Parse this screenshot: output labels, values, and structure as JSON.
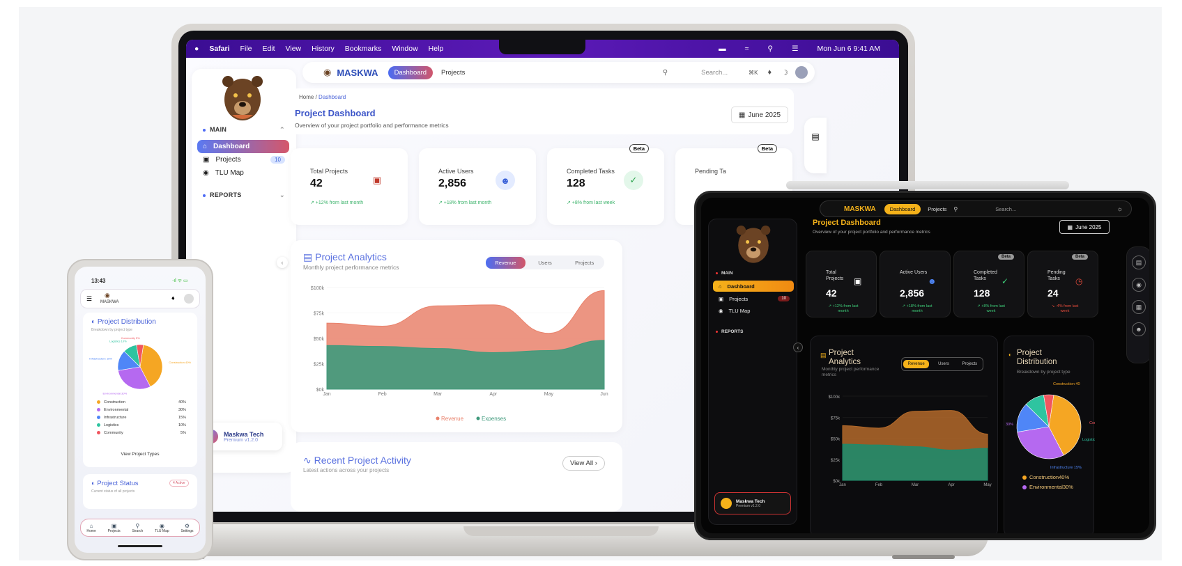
{
  "laptop": {
    "menubar": {
      "apple": "",
      "app": "Safari",
      "menus": [
        "File",
        "Edit",
        "View",
        "History",
        "Bookmarks",
        "Window",
        "Help"
      ],
      "datetime": "Mon Jun 6  9:41 AM"
    },
    "sidebar": {
      "section_main": "MAIN",
      "items": [
        {
          "label": "Dashboard",
          "icon": "home-icon"
        },
        {
          "label": "Projects",
          "icon": "briefcase-icon",
          "badge": "10"
        },
        {
          "label": "TLU Map",
          "icon": "map-pin-icon"
        }
      ],
      "section_reports": "REPORTS",
      "user": {
        "name": "Maskwa Tech",
        "sub": "Premium v1.2.0"
      }
    },
    "topbar": {
      "brand": "MASKWA",
      "tab_dashboard": "Dashboard",
      "tab_projects": "Projects",
      "search_placeholder": "Search...",
      "shortcut": "⌘K"
    },
    "header": {
      "crumb_home": "Home",
      "crumb_sep": "/",
      "crumb_current": "Dashboard",
      "title": "Project Dashboard",
      "subtitle": "Overview of your project portfolio and performance metrics",
      "date": "June 2025"
    },
    "stats": [
      {
        "label": "Total Projects",
        "value": "42",
        "change": "↗ +12% from last month",
        "icon": "briefcase-icon",
        "icon_color": "#c0392b"
      },
      {
        "label": "Active Users",
        "value": "2,856",
        "change": "↗ +18% from last month",
        "icon": "users-icon",
        "icon_color": "#3b62d8"
      },
      {
        "label": "Completed Tasks",
        "value": "128",
        "change": "↗ +8% from last week",
        "icon": "check-circle-icon",
        "icon_color": "#2ea44f",
        "badge": "Beta"
      },
      {
        "label": "Pending Ta",
        "value": "",
        "change": "",
        "badge": "Beta"
      }
    ],
    "analytics": {
      "title": "Project Analytics",
      "subtitle": "Monthly project performance metrics",
      "tabs": [
        "Revenue",
        "Users",
        "Projects"
      ],
      "active_tab": "Revenue"
    },
    "recent": {
      "title": "Recent Project Activity",
      "subtitle": "Latest actions across your projects",
      "view_all": "View All ›"
    }
  },
  "chart_data": [
    {
      "type": "area",
      "x": [
        "Jan",
        "Feb",
        "Mar",
        "Apr",
        "May",
        "Jun"
      ],
      "ylabels": [
        "$0k",
        "$25k",
        "$50k",
        "$75k",
        "$100k"
      ],
      "ylim": [
        0,
        100000
      ],
      "series": [
        {
          "name": "Revenue",
          "color": "#e9826c",
          "values": [
            65000,
            62000,
            82000,
            83000,
            55000,
            97000
          ]
        },
        {
          "name": "Expenses",
          "color": "#3f9a7c",
          "values": [
            43000,
            42000,
            40000,
            36000,
            38000,
            48000
          ]
        }
      ],
      "legend": "bottom"
    },
    {
      "type": "pie",
      "title": "Project Distribution",
      "subtitle": "Breakdown by project type",
      "categories": [
        "Construction",
        "Environmental",
        "Infrastructure",
        "Logistics",
        "Community"
      ],
      "values": [
        40,
        30,
        15,
        10,
        5
      ],
      "colors": [
        "#f5a623",
        "#b569f0",
        "#4f86f7",
        "#2ec4a0",
        "#f0565f"
      ],
      "labels": [
        "Construction 40%",
        "Environmental 30%",
        "Infrastructure 15%",
        "Logistics 10%",
        "Community 5%"
      ],
      "legend_values": [
        "40%",
        "30%",
        "15%",
        "10%",
        "5%"
      ]
    }
  ],
  "phone": {
    "time": "13:43",
    "status": "⋅ıl ᯤ ▭",
    "brand": "MASKWA",
    "dist_title": "Project Distribution",
    "dist_sub": "Breakdown by project type",
    "view_types": "View Project Types",
    "status_title": "Project Status",
    "status_sub": "Current status of all projects",
    "status_badge": "4 Active",
    "nav": [
      {
        "label": "Home",
        "icon": "home-icon"
      },
      {
        "label": "Projects",
        "icon": "folder-icon"
      },
      {
        "label": "Search",
        "icon": "search-icon"
      },
      {
        "label": "TLU Map",
        "icon": "map-pin-icon"
      },
      {
        "label": "Settings",
        "icon": "gear-icon"
      }
    ]
  },
  "tablet": {
    "brand": "MASKWA",
    "tab_dashboard": "Dashboard",
    "tab_projects": "Projects",
    "search_placeholder": "Search...",
    "title": "Project Dashboard",
    "subtitle": "Overview of your project portfolio and performance metrics",
    "date": "June 2025",
    "section_main": "MAIN",
    "items": [
      {
        "label": "Dashboard"
      },
      {
        "label": "Projects",
        "badge": "10"
      },
      {
        "label": "TLU Map"
      }
    ],
    "section_reports": "REPORTS",
    "user": {
      "name": "Maskwa Tech",
      "sub": "Premium v1.2.0"
    },
    "stats": [
      {
        "label": "Total Projects",
        "value": "42",
        "change": "↗ +12% from last month",
        "color": "#3ecf7a"
      },
      {
        "label": "Active Users",
        "value": "2,856",
        "change": "↗ +18% from last month",
        "color": "#3ecf7a"
      },
      {
        "label": "Completed Tasks",
        "value": "128",
        "change": "↗ +8% from last week",
        "color": "#3ecf7a",
        "badge": "Beta"
      },
      {
        "label": "Pending Tasks",
        "value": "24",
        "change": "↘ -4% from last week",
        "color": "#e74c3c",
        "badge": "Beta"
      }
    ],
    "analytics": {
      "title": "Project Analytics",
      "subtitle": "Monthly project performance metrics",
      "tabs": [
        "Revenue",
        "Users",
        "Projects"
      ]
    },
    "distribution": {
      "title": "Project Distribution",
      "subtitle": "Breakdown by project type",
      "legend": [
        "Construction40%",
        "Environmental30%"
      ],
      "slice_labels": [
        "Construction 40",
        "Com",
        "Logistic",
        "Infrastructure 15%",
        "30%"
      ]
    },
    "chart_ylabels": [
      "$0k",
      "$25k",
      "$50k",
      "$75k",
      "$100k"
    ],
    "chart_x": [
      "Jan",
      "Feb",
      "Mar",
      "Apr",
      "May"
    ]
  }
}
